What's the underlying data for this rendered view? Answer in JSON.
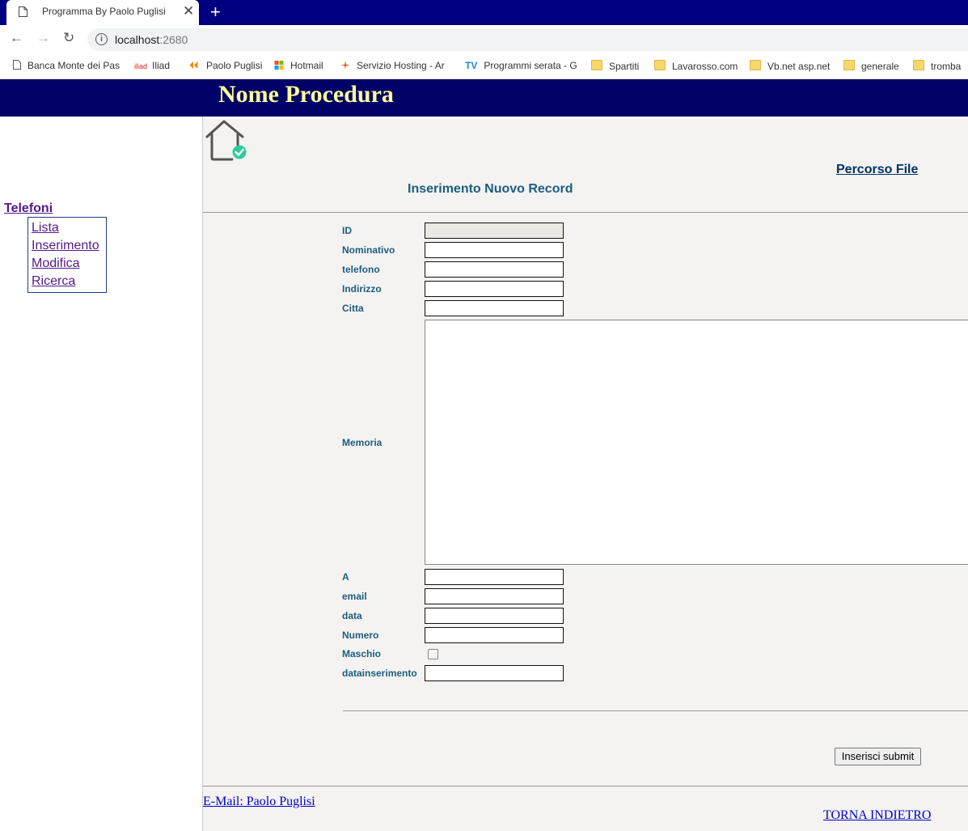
{
  "browser": {
    "tab_title": "Programma By Paolo Puglisi",
    "close_glyph": "✕",
    "newtab_glyph": "+",
    "url_host": "localhost",
    "url_port": ":2680",
    "nav": {
      "back": "←",
      "forward": "→",
      "reload": "↻"
    },
    "bookmarks": [
      "Banca Monte dei Pas",
      "Iliad",
      "Paolo Puglisi",
      "Hotmail",
      "Servizio Hosting - Ar",
      "Programmi serata - G",
      "Spartiti",
      "Lavarosso.com",
      "Vb.net asp.net",
      "generale",
      "tromba"
    ],
    "bookmark_icons": {
      "iliad": "iliad",
      "tv": "TV"
    }
  },
  "header": {
    "title": "Nome Procedura"
  },
  "sidebar": {
    "heading": "Telefoni",
    "items": [
      "Lista",
      "Inserimento",
      "Modifica",
      "Ricerca"
    ]
  },
  "content": {
    "percorso_link": "Percorso File",
    "form_title": "Inserimento Nuovo Record",
    "fields": {
      "id": "ID",
      "nominativo": "Nominativo",
      "telefono": "telefono",
      "indirizzo": "Indirizzo",
      "citta": "Citta",
      "memoria": "Memoria",
      "a": "A",
      "email": "email",
      "data": "data",
      "numero": "Numero",
      "maschio": "Maschio",
      "datainserimento": "datainserimento"
    },
    "submit_label": "Inserisci submit",
    "email_link": "E-Mail: Paolo Puglisi",
    "back_link": "TORNA INDIETRO"
  },
  "colors": {
    "tabbar": "#000080",
    "header_bg": "#000066",
    "header_text": "#ffff99",
    "label_text": "#1c5d80"
  }
}
